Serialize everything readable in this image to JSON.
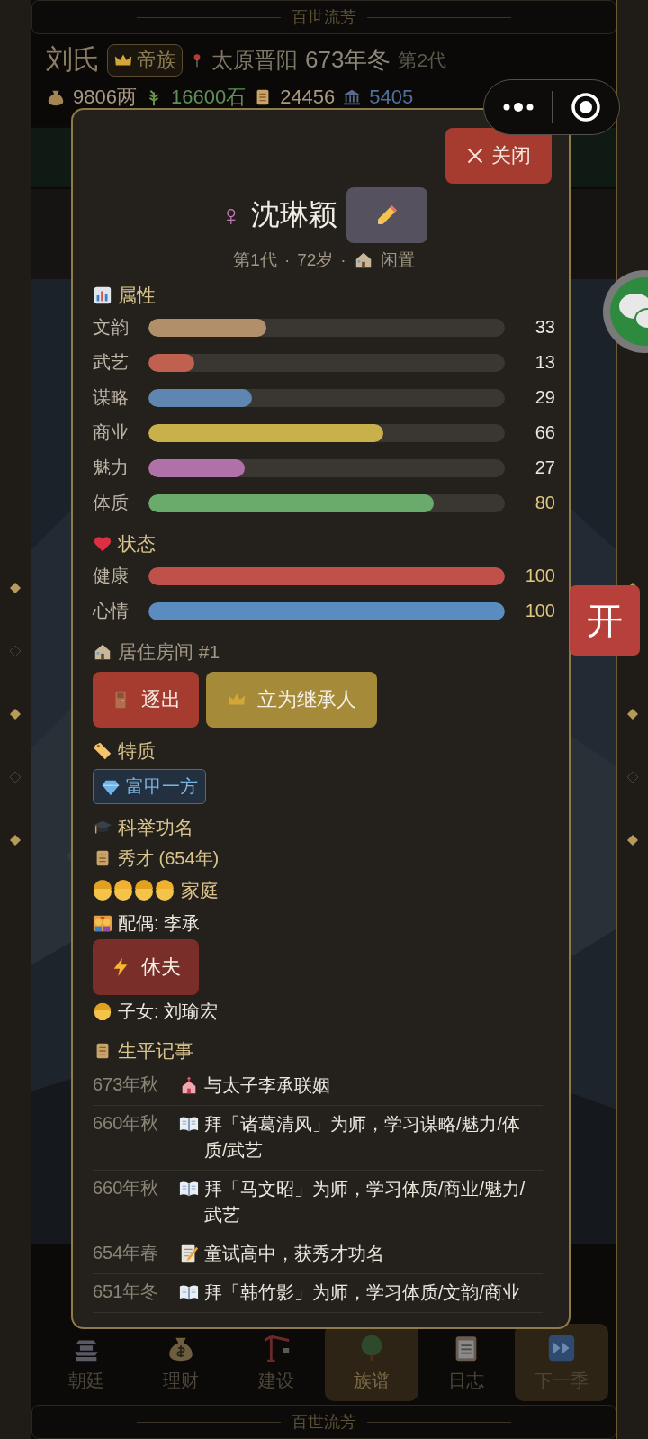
{
  "top_banner": {
    "title": "百世流芳"
  },
  "header": {
    "family": "刘氏",
    "rank": "帝族",
    "location": "太原晋阳",
    "date": "673年冬",
    "generation": "第2代"
  },
  "resources": [
    {
      "kind": "money",
      "value": "9806两",
      "color": "#a89a82"
    },
    {
      "kind": "grain",
      "value": "16600石",
      "color": "#5f8f5a"
    },
    {
      "kind": "scroll",
      "value": "24456",
      "color": "#a89a82"
    },
    {
      "kind": "hall",
      "value": "5405",
      "color": "#4f6f9a"
    }
  ],
  "modal": {
    "close": "关闭",
    "gender": "♀",
    "name": "沈琳颖",
    "generation": "第1代",
    "age": "72岁",
    "status": "闲置",
    "separators": [
      "·",
      "·"
    ],
    "attributes_title": "属性",
    "attributes": [
      {
        "label": "文韵",
        "level": 0.33,
        "value": "33",
        "color": "#b08f6a",
        "highlighted": false
      },
      {
        "label": "武艺",
        "level": 0.13,
        "value": "13",
        "color": "#c0604f",
        "highlighted": false
      },
      {
        "label": "谋略",
        "level": 0.29,
        "value": "29",
        "color": "#5f86b0",
        "highlighted": false
      },
      {
        "label": "商业",
        "level": 0.66,
        "value": "66",
        "color": "#c8b04a",
        "highlighted": false
      },
      {
        "label": "魅力",
        "level": 0.27,
        "value": "27",
        "color": "#b070a8",
        "highlighted": false
      },
      {
        "label": "体质",
        "level": 0.8,
        "value": "80",
        "color": "#6aaa6a",
        "highlighted": true
      }
    ],
    "status_title": "状态",
    "status_bars": [
      {
        "label": "健康",
        "level": 1,
        "value": "100",
        "color": "#c0504a",
        "highlighted": true
      },
      {
        "label": "心情",
        "level": 1,
        "value": "100",
        "color": "#5a8cc0",
        "highlighted": true
      }
    ],
    "room": "居住房间 #1",
    "actions": [
      {
        "kind": "expel",
        "label": "逐出"
      },
      {
        "kind": "heir",
        "label": "立为继承人"
      }
    ],
    "traits_title": "特质",
    "traits": [
      "富甲一方"
    ],
    "exam_title": "科举功名",
    "exam": "秀才 (654年)",
    "family_title": "家庭",
    "spouse": "配偶: 李承",
    "divorce": "休夫",
    "children": "子女: 刘瑜宏",
    "events_title": "生平记事",
    "events": [
      {
        "date": "673年秋",
        "kind": "marriage",
        "text": "与太子李承联姻"
      },
      {
        "date": "660年秋",
        "kind": "study",
        "text": "拜「诸葛清风」为师，学习谋略/魅力/体质/武艺"
      },
      {
        "date": "660年秋",
        "kind": "study",
        "text": "拜「马文昭」为师，学习体质/商业/魅力/武艺"
      },
      {
        "date": "654年春",
        "kind": "exam",
        "text": "童试高中，获秀才功名"
      },
      {
        "date": "651年冬",
        "kind": "study",
        "text": "拜「韩竹影」为师，学习体质/文韵/商业"
      }
    ]
  },
  "bottom_nav": [
    {
      "label": "朝廷",
      "selected": false,
      "highlighted": false
    },
    {
      "label": "理财",
      "selected": false,
      "highlighted": false
    },
    {
      "label": "建设",
      "selected": false,
      "highlighted": false
    },
    {
      "label": "族谱",
      "selected": true,
      "highlighted": false
    },
    {
      "label": "日志",
      "selected": false,
      "highlighted": false
    },
    {
      "label": "下一季",
      "selected": false,
      "highlighted": true
    }
  ],
  "bottom_banner": {
    "title": "百世流芳"
  },
  "open_button": "开"
}
